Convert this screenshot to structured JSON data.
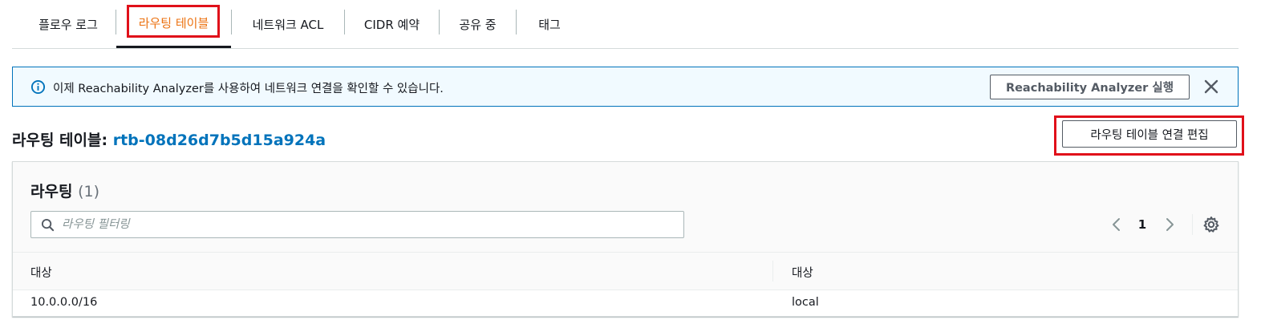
{
  "tabs": [
    {
      "label": "플로우 로그",
      "active": false
    },
    {
      "label": "라우팅 테이블",
      "active": true
    },
    {
      "label": "네트워크 ACL",
      "active": false
    },
    {
      "label": "CIDR 예약",
      "active": false
    },
    {
      "label": "공유 중",
      "active": false
    },
    {
      "label": "태그",
      "active": false
    }
  ],
  "alert": {
    "icon": "info-circle-icon",
    "text": "이제 Reachability Analyzer를 사용하여 네트워크 연결을 확인할 수 있습니다.",
    "button_label": "Reachability Analyzer 실행",
    "close_icon": "close-icon"
  },
  "heading": {
    "label": "라우팅 테이블:",
    "route_table_id": "rtb-08d26d7b5d15a924a",
    "edit_button_label": "라우팅 테이블 연결 편집"
  },
  "routes_panel": {
    "title": "라우팅",
    "count": "(1)",
    "search_placeholder": "라우팅 필터링",
    "search_value": "",
    "page_number": "1",
    "columns": [
      "대상",
      "대상"
    ],
    "rows": [
      {
        "destination": "10.0.0.0/16",
        "target": "local"
      }
    ]
  },
  "colors": {
    "accent_orange": "#ec7211",
    "link_blue": "#0073bb",
    "highlight_red": "#e0101a",
    "alert_bg": "#f1faff"
  }
}
